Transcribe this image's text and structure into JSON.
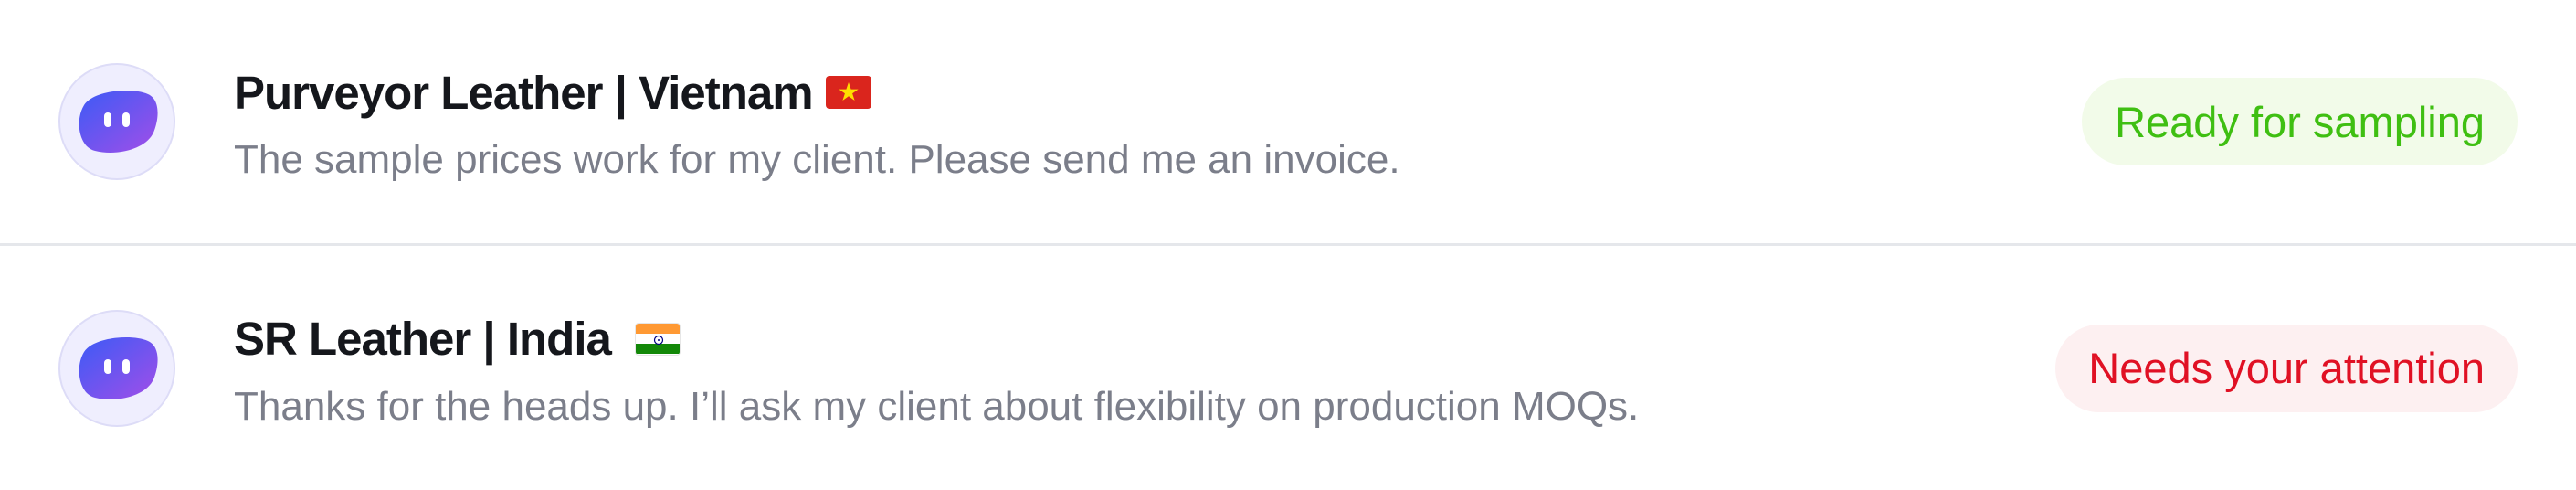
{
  "conversations": [
    {
      "name": "Purveyor Leather | Vietnam",
      "flag": "vietnam-flag",
      "message": "The sample prices work for my client. Please send me an invoice.",
      "status": "Ready for sampling",
      "status_color": "#3fbf12",
      "status_bg": "#f2fbe9"
    },
    {
      "name": "SR Leather | India",
      "flag": "india-flag",
      "message": "Thanks for the heads up. I’ll ask my client about flexibility on production MOQs.",
      "status": "Needs your attention",
      "status_color": "#e01124",
      "status_bg": "#fdf0f1"
    }
  ],
  "colors": {
    "avatar_gradient_start": "#3b5bf6",
    "avatar_gradient_end": "#a24ee8",
    "divider": "#e5e7eb"
  }
}
